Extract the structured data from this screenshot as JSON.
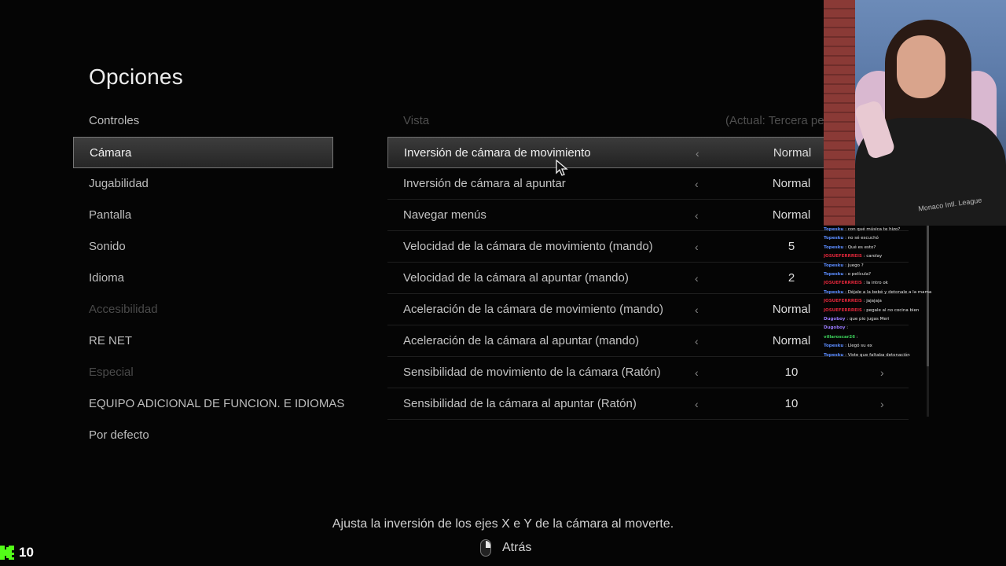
{
  "page": {
    "title": "Opciones"
  },
  "menu": {
    "items": [
      {
        "label": "Controles",
        "state": "normal"
      },
      {
        "label": "Cámara",
        "state": "active"
      },
      {
        "label": "Jugabilidad",
        "state": "normal"
      },
      {
        "label": "Pantalla",
        "state": "normal"
      },
      {
        "label": "Sonido",
        "state": "normal"
      },
      {
        "label": "Idioma",
        "state": "normal"
      },
      {
        "label": "Accesibilidad",
        "state": "disabled"
      },
      {
        "label": "RE NET",
        "state": "normal"
      },
      {
        "label": "Especial",
        "state": "disabled"
      },
      {
        "label": "EQUIPO ADICIONAL DE FUNCION. E IDIOMAS",
        "state": "normal"
      },
      {
        "label": "Por defecto",
        "state": "normal"
      }
    ]
  },
  "settings": {
    "header": {
      "label": "Vista",
      "value": "(Actual: Tercera pe"
    },
    "rows": [
      {
        "label": "Inversión de cámara de movimiento",
        "value": "Normal"
      },
      {
        "label": "Inversión de cámara al apuntar",
        "value": "Normal"
      },
      {
        "label": "Navegar menús",
        "value": "Normal"
      },
      {
        "label": "Velocidad de la cámara de movimiento (mando)",
        "value": "5"
      },
      {
        "label": "Velocidad de la cámara al apuntar (mando)",
        "value": "2"
      },
      {
        "label": "Aceleración de la cámara de movimiento (mando)",
        "value": "Normal"
      },
      {
        "label": "Aceleración de la cámara al apuntar (mando)",
        "value": "Normal"
      },
      {
        "label": "Sensibilidad de movimiento de la cámara (Ratón)",
        "value": "10"
      },
      {
        "label": "Sensibilidad de la cámara al apuntar (Ratón)",
        "value": "10"
      }
    ],
    "left_arrow": "‹",
    "right_arrow": "›"
  },
  "footer": {
    "help_text": "Ajusta la inversión de los ejes X e Y de la cámara al moverte.",
    "back_label": "Atrás"
  },
  "overlay": {
    "kick_count": "10",
    "webcam_shirt_text": "Monaco Intl. League",
    "chat": [
      {
        "user": "Topesku",
        "msg": "con qué música te hizo?",
        "color": "#5b8cff"
      },
      {
        "user": "Topesku",
        "msg": "no sé escuchó",
        "color": "#5b8cff"
      },
      {
        "user": "Topesku",
        "msg": "Qué es esto?",
        "color": "#5b8cff"
      },
      {
        "user": "JOSUEFERRREIS",
        "msg": "carolay",
        "color": "#e0263a"
      },
      {
        "user": "Topesku",
        "msg": "juego ?",
        "color": "#5b8cff"
      },
      {
        "user": "Topesku",
        "msg": "o película?",
        "color": "#5b8cff"
      },
      {
        "user": "JOSUEFERRREIS",
        "msg": "la intro ok",
        "color": "#e0263a"
      },
      {
        "user": "Topesku",
        "msg": "Déjale a la bebé y detonale a la mama",
        "color": "#5b8cff"
      },
      {
        "user": "JOSUEFERRREIS",
        "msg": "jajajaja",
        "color": "#e0263a"
      },
      {
        "user": "JOSUEFERRREIS",
        "msg": "pegale al no cocina bien",
        "color": "#e0263a"
      },
      {
        "user": "Dugoboy",
        "msg": "que pio jugas Meri",
        "color": "#9b7bff"
      },
      {
        "user": "Dugoboy",
        "msg": "",
        "color": "#9b7bff"
      },
      {
        "user": "villaroscar26",
        "msg": "",
        "color": "#3ccf5a"
      },
      {
        "user": "Topesku",
        "msg": "Llegó su ex",
        "color": "#5b8cff"
      },
      {
        "user": "Topesku",
        "msg": "Viste que faltaba detonación",
        "color": "#5b8cff"
      }
    ]
  },
  "colors": {
    "kick_green": "#53fc18",
    "background": "#050505"
  }
}
